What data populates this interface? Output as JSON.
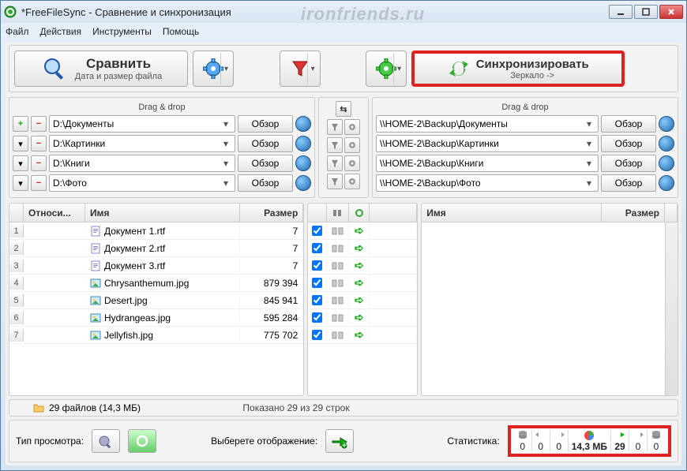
{
  "window": {
    "title": "*FreeFileSync - Сравнение и синхронизация",
    "watermark": "ironfriends.ru"
  },
  "menu": {
    "file": "Файл",
    "actions": "Действия",
    "tools": "Инструменты",
    "help": "Помощь"
  },
  "toolbar": {
    "compare": {
      "title": "Сравнить",
      "subtitle": "Дата и размер файла"
    },
    "sync": {
      "title": "Синхронизировать",
      "subtitle": "Зеркало ->"
    }
  },
  "paths": {
    "drag_drop": "Drag & drop",
    "browse": "Обзор",
    "left": [
      "D:\\Документы",
      "D:\\Картинки",
      "D:\\Книги",
      "D:\\Фото"
    ],
    "right": [
      "\\\\HOME-2\\Backup\\Документы",
      "\\\\HOME-2\\Backup\\Картинки",
      "\\\\HOME-2\\Backup\\Книги",
      "\\\\HOME-2\\Backup\\Фото"
    ]
  },
  "grid": {
    "headers": {
      "rel": "Относи...",
      "name": "Имя",
      "size": "Размер"
    },
    "rows": [
      {
        "n": "1",
        "name": "Документ 1.rtf",
        "size": "7",
        "type": "doc"
      },
      {
        "n": "2",
        "name": "Документ 2.rtf",
        "size": "7",
        "type": "doc"
      },
      {
        "n": "3",
        "name": "Документ 3.rtf",
        "size": "7",
        "type": "doc"
      },
      {
        "n": "4",
        "name": "Chrysanthemum.jpg",
        "size": "879 394",
        "type": "img"
      },
      {
        "n": "5",
        "name": "Desert.jpg",
        "size": "845 941",
        "type": "img"
      },
      {
        "n": "6",
        "name": "Hydrangeas.jpg",
        "size": "595 284",
        "type": "img"
      },
      {
        "n": "7",
        "name": "Jellyfish.jpg",
        "size": "775 702",
        "type": "img"
      }
    ]
  },
  "footer": {
    "left": "29 файлов (14,3 МБ)",
    "right": "Показано 29 из 29 строк"
  },
  "status": {
    "view_label": "Тип просмотра:",
    "display_label": "Выберете отображение:",
    "stats_label": "Статистика:",
    "stats": [
      {
        "icon": "db-left",
        "val": "0"
      },
      {
        "icon": "arr-left",
        "val": "0"
      },
      {
        "icon": "up-left",
        "val": "0"
      },
      {
        "icon": "pie",
        "val": "14,3 МБ",
        "bold": true
      },
      {
        "icon": "arr-green",
        "val": "29",
        "bold": true
      },
      {
        "icon": "up-right",
        "val": "0"
      },
      {
        "icon": "db-right",
        "val": "0"
      }
    ]
  }
}
